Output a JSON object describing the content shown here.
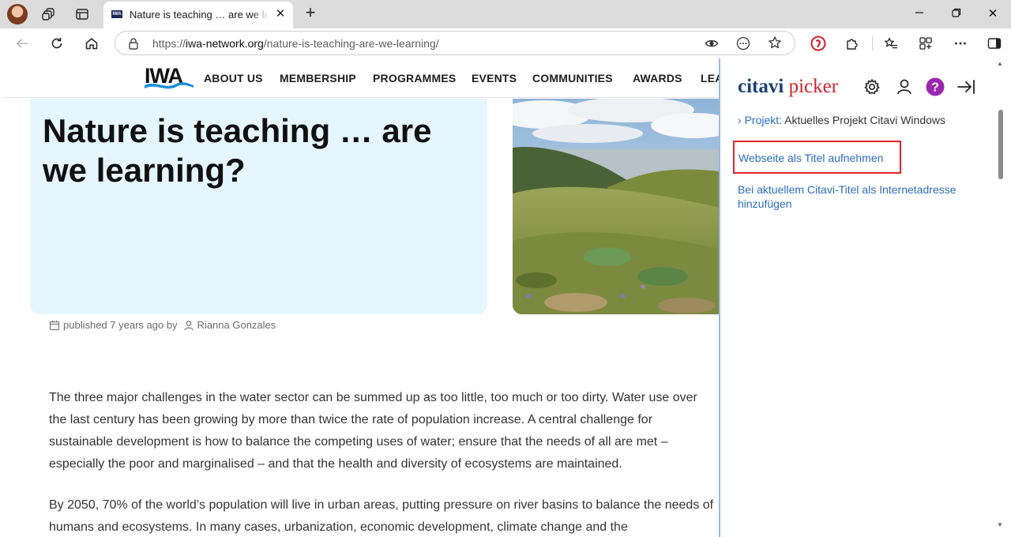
{
  "browser": {
    "tab_title": "Nature is teaching … are we learning?",
    "tab_favicon_text": "IWA",
    "url_prefix": "https://",
    "url_host": "iwa-network.org",
    "url_path": "/nature-is-teaching-are-we-learning/"
  },
  "site": {
    "logo_text": "IWA",
    "nav": [
      "ABOUT US",
      "MEMBERSHIP",
      "PROGRAMMES",
      "EVENTS",
      "COMMUNITIES",
      "AWARDS",
      "LEA"
    ]
  },
  "article": {
    "title": "Nature is teaching … are we learning?",
    "published": "published 7 years ago by",
    "author": "Rianna Gonzales",
    "paragraphs": [
      "The three major challenges in the water sector can be summed up as too little, too much or too dirty. Water use over the last century has been growing by more than twice the rate of population increase. A central challenge for sustainable development is how to balance the competing uses of water; ensure that the needs of all are met – especially the poor and marginalised – and that the health and diversity of ecosystems are maintained.",
      "By 2050, 70% of the world’s population will live in urban areas, putting pressure on river basins to balance the needs of humans and ecosystems. In many cases, urbanization, economic development, climate change and the"
    ]
  },
  "citavi": {
    "brand_part1": "citavi",
    "brand_part2": "picker",
    "project_label": "Projekt:",
    "project_name": "Aktuelles Projekt Citavi Windows",
    "action_add_title": "Webseite als Titel aufnehmen",
    "action_add_url": "Bei aktuellem Citavi-Titel als Internetadresse hinzufügen"
  },
  "colors": {
    "accent_blue": "#2b6cc4",
    "highlight_red": "#e0242c",
    "hero_bg": "#e6f6fe",
    "help_purple": "#9b27b0"
  }
}
